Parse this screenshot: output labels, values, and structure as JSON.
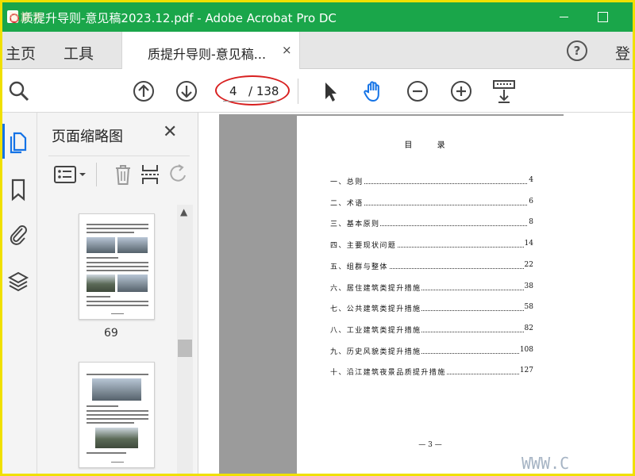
{
  "window": {
    "title": "质提升导则-意见稿2023.12.pdf - Adobe Acrobat Pro DC",
    "watermark_text": "腿旋天"
  },
  "tabbar": {
    "home": "主页",
    "tools": "工具",
    "doc_tab": "质提升导则-意见稿...",
    "close_glyph": "×",
    "help": "?",
    "login": "登"
  },
  "toolbar": {
    "page_current": "4",
    "page_total": "/ 138",
    "icons": [
      "search-icon",
      "prev-page-icon",
      "next-page-icon",
      "select-arrow-icon",
      "hand-icon",
      "zoom-out-icon",
      "zoom-in-icon",
      "scroll-mode-icon"
    ],
    "hand_color": "#1473e6",
    "highlight_color": "#d82020"
  },
  "rail": {
    "icons": [
      "pages-icon",
      "bookmark-icon",
      "attachment-icon",
      "layers-icon"
    ]
  },
  "panel": {
    "title": "页面缩略图",
    "close_glyph": "✕",
    "thumbnails": [
      {
        "label": "69"
      },
      {
        "label": ""
      }
    ]
  },
  "document": {
    "toc_title": "目 录",
    "toc": [
      {
        "text": "一、总则",
        "page": "4"
      },
      {
        "text": "二、术语",
        "page": "6"
      },
      {
        "text": "三、基本原则",
        "page": "8"
      },
      {
        "text": "四、主要现状问题",
        "page": "14"
      },
      {
        "text": "五、组群与整体",
        "page": "22"
      },
      {
        "text": "六、居住建筑类提升措施",
        "page": "38"
      },
      {
        "text": "七、公共建筑类提升措施",
        "page": "58"
      },
      {
        "text": "八、工业建筑类提升措施",
        "page": "82"
      },
      {
        "text": "九、历史风貌类提升措施",
        "page": "108"
      },
      {
        "text": "十、沿江建筑夜景品质提升措施",
        "page": "127"
      }
    ],
    "footer": "— 3 —",
    "corner_watermark": "WWW.C"
  }
}
